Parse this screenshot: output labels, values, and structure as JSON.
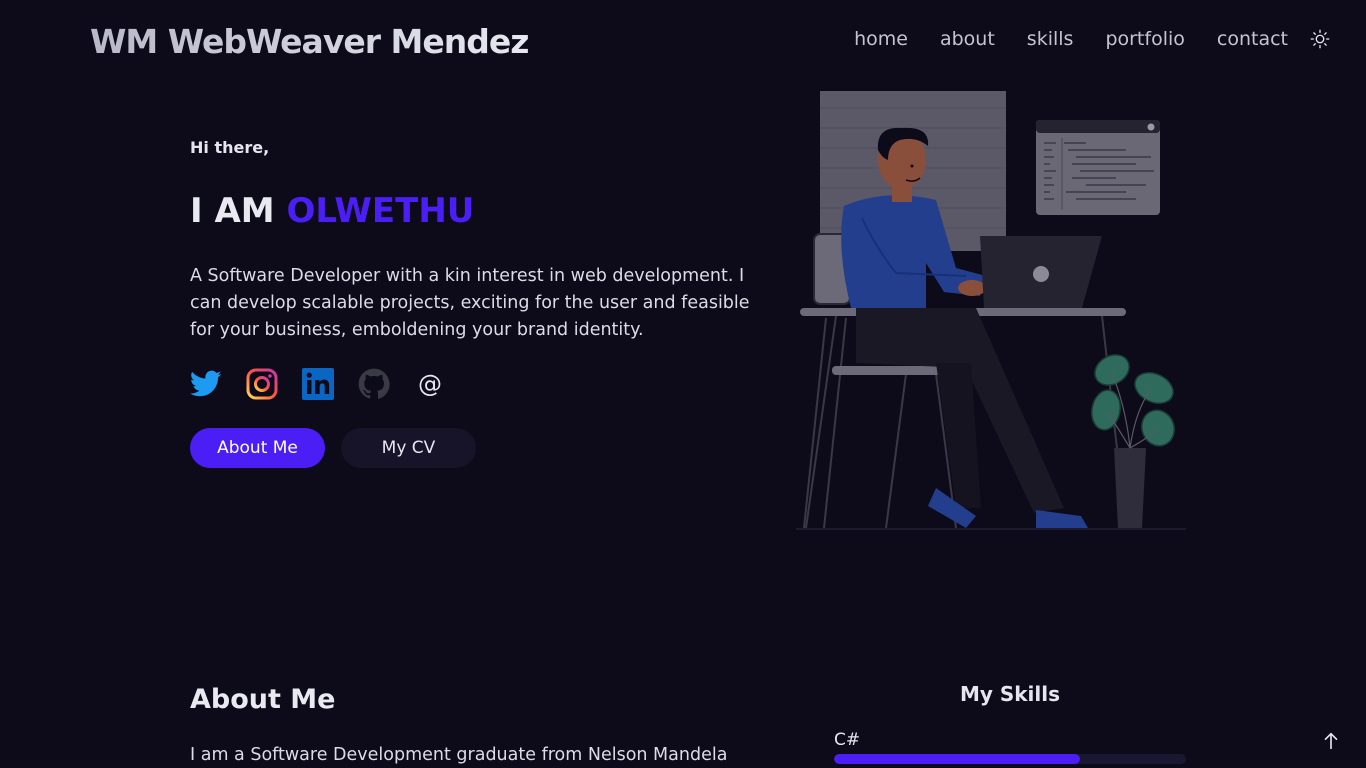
{
  "header": {
    "logo": "WM WebWeaver Mendez",
    "nav": [
      "home",
      "about",
      "skills",
      "portfolio",
      "contact"
    ],
    "theme_icon": "sun-icon"
  },
  "hero": {
    "greeting": "Hi there,",
    "title_prefix": "I AM",
    "title_name": "OLWETHU",
    "description": "A Software Developer with a kin interest in web development. I can develop scalable projects, exciting for the user and feasible for your business, emboldening your brand identity.",
    "socials": [
      "twitter-icon",
      "instagram-icon",
      "linkedin-icon",
      "github-icon",
      "email-icon"
    ],
    "email_symbol": "@",
    "primary_button": "About Me",
    "secondary_button": "My CV"
  },
  "about": {
    "heading": "About Me",
    "text": "I am a Software Development graduate from Nelson Mandela"
  },
  "skills": {
    "heading": "My Skills",
    "items": [
      {
        "name": "C#",
        "level": 0.7
      }
    ]
  },
  "colors": {
    "background": "#0d0a1a",
    "accent": "#4a1ef5",
    "secondary_button": "#17142a"
  }
}
